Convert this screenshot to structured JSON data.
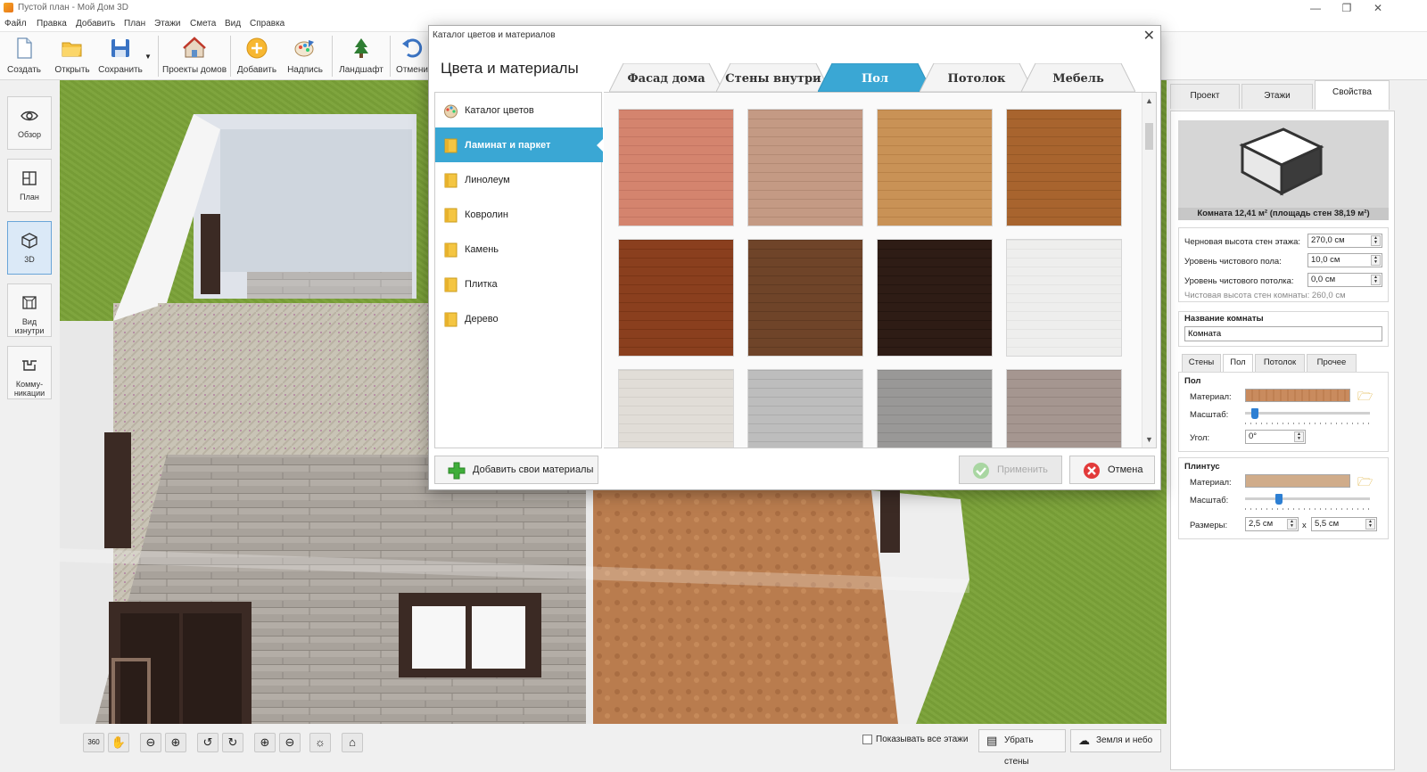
{
  "window": {
    "title": "Пустой план - Мой Дом 3D",
    "controls": [
      "minimize",
      "restore",
      "close"
    ]
  },
  "menu": [
    "Файл",
    "Правка",
    "Добавить",
    "План",
    "Этажи",
    "Смета",
    "Вид",
    "Справка"
  ],
  "toolbar": {
    "buttons": [
      {
        "label": "Создать",
        "icon": "new-file-icon"
      },
      {
        "label": "Открыть",
        "icon": "open-folder-icon"
      },
      {
        "label": "Сохранить",
        "icon": "save-icon"
      },
      {
        "label": "Проекты домов",
        "icon": "house-projects-icon"
      },
      {
        "label": "Добавить",
        "icon": "add-icon"
      },
      {
        "label": "Надпись",
        "icon": "label-icon"
      },
      {
        "label": "Ландшафт",
        "icon": "tree-icon"
      },
      {
        "label": "Отмени",
        "icon": "undo-icon"
      }
    ]
  },
  "left_rail": [
    {
      "label": "Обзор",
      "icon": "eye-icon",
      "active": false
    },
    {
      "label": "План",
      "icon": "plan-icon",
      "active": false
    },
    {
      "label": "3D",
      "icon": "cube-3d-icon",
      "active": true
    },
    {
      "label": "Вид изнутри",
      "icon": "inside-view-icon",
      "active": false
    },
    {
      "label": "Комму-никации",
      "icon": "communications-icon",
      "active": false
    }
  ],
  "dialog": {
    "title": "Каталог цветов и материалов",
    "heading": "Цвета и материалы",
    "tabs": [
      "Фасад дома",
      "Стены внутри",
      "Пол",
      "Потолок",
      "Мебель"
    ],
    "active_tab": "Пол",
    "categories": [
      {
        "label": "Каталог цветов",
        "icon": "palette-icon",
        "selected": false
      },
      {
        "label": "Ламинат и паркет",
        "icon": "folder-icon",
        "selected": true
      },
      {
        "label": "Линолеум",
        "icon": "folder-icon",
        "selected": false
      },
      {
        "label": "Ковролин",
        "icon": "folder-icon",
        "selected": false
      },
      {
        "label": "Камень",
        "icon": "folder-icon",
        "selected": false
      },
      {
        "label": "Плитка",
        "icon": "folder-icon",
        "selected": false
      },
      {
        "label": "Дерево",
        "icon": "folder-icon",
        "selected": false
      }
    ],
    "swatches": [
      {
        "color": "#d4846e",
        "stripe": "#c47662"
      },
      {
        "color": "#c49a84",
        "stripe": "#b38a74"
      },
      {
        "color": "#c99256",
        "stripe": "#b98248"
      },
      {
        "color": "#a8642e",
        "stripe": "#965826"
      },
      {
        "color": "#8a3f1e",
        "stripe": "#7a3516"
      },
      {
        "color": "#6f4429",
        "stripe": "#603a22"
      },
      {
        "color": "#2e1c15",
        "stripe": "#24150f"
      },
      {
        "color": "#eeeeed",
        "stripe": "#e4e4e3"
      },
      {
        "color": "#e1ddd7",
        "stripe": "#d4d0ca"
      },
      {
        "color": "#bdbdbd",
        "stripe": "#acacac"
      },
      {
        "color": "#999897",
        "stripe": "#8a8988"
      },
      {
        "color": "#a59690",
        "stripe": "#958680"
      }
    ],
    "add_button": "Добавить свои материалы",
    "apply_button": "Применить",
    "cancel_button": "Отмена"
  },
  "bottom_bar": {
    "tools": [
      "360-icon",
      "hand-icon",
      "zoom-out-icon",
      "zoom-in-icon",
      "rotate-left-icon",
      "rotate-right-icon",
      "tilt-up-icon",
      "tilt-down-icon",
      "light-icon",
      "home-icon"
    ],
    "tool_360_label": "360",
    "show_all_floors": "Показывать все этажи",
    "remove_walls": "Убрать стены",
    "earth_sky": "Земля и небо"
  },
  "right_panel": {
    "tabs": [
      "Проект",
      "Этажи",
      "Свойства"
    ],
    "active_tab": "Свойства",
    "preview_caption": "Комната 12,41 м²  (площадь стен 38,19 м²)",
    "fields": [
      {
        "label": "Черновая высота стен этажа:",
        "value": "270,0 см"
      },
      {
        "label": "Уровень чистового пола:",
        "value": "10,0 см"
      },
      {
        "label": "Уровень чистового потолка:",
        "value": "0,0 см"
      }
    ],
    "clear_height": "Чистовая высота стен комнаты: 260,0 см",
    "room_name_label": "Название комнаты",
    "room_name_value": "Комната",
    "subtabs": [
      "Стены",
      "Пол",
      "Потолок",
      "Прочее"
    ],
    "active_subtab": "Пол",
    "floor_group": {
      "title": "Пол",
      "material_label": "Материал:",
      "material_color": "#c98b5e",
      "scale_label": "Масштаб:",
      "scale_level": 0.08,
      "angle_label": "Угол:",
      "angle_value": "0°"
    },
    "plinth_group": {
      "title": "Плинтус",
      "material_label": "Материал:",
      "material_color": "#d0ac8a",
      "scale_label": "Масштаб:",
      "scale_level": 0.27,
      "sizes_label": "Размеры:",
      "size_a": "2,5 см",
      "size_x": "x",
      "size_b": "5,5 см"
    }
  },
  "colors": {
    "accent": "#3aa7d4",
    "grass": "#7ca23c"
  }
}
